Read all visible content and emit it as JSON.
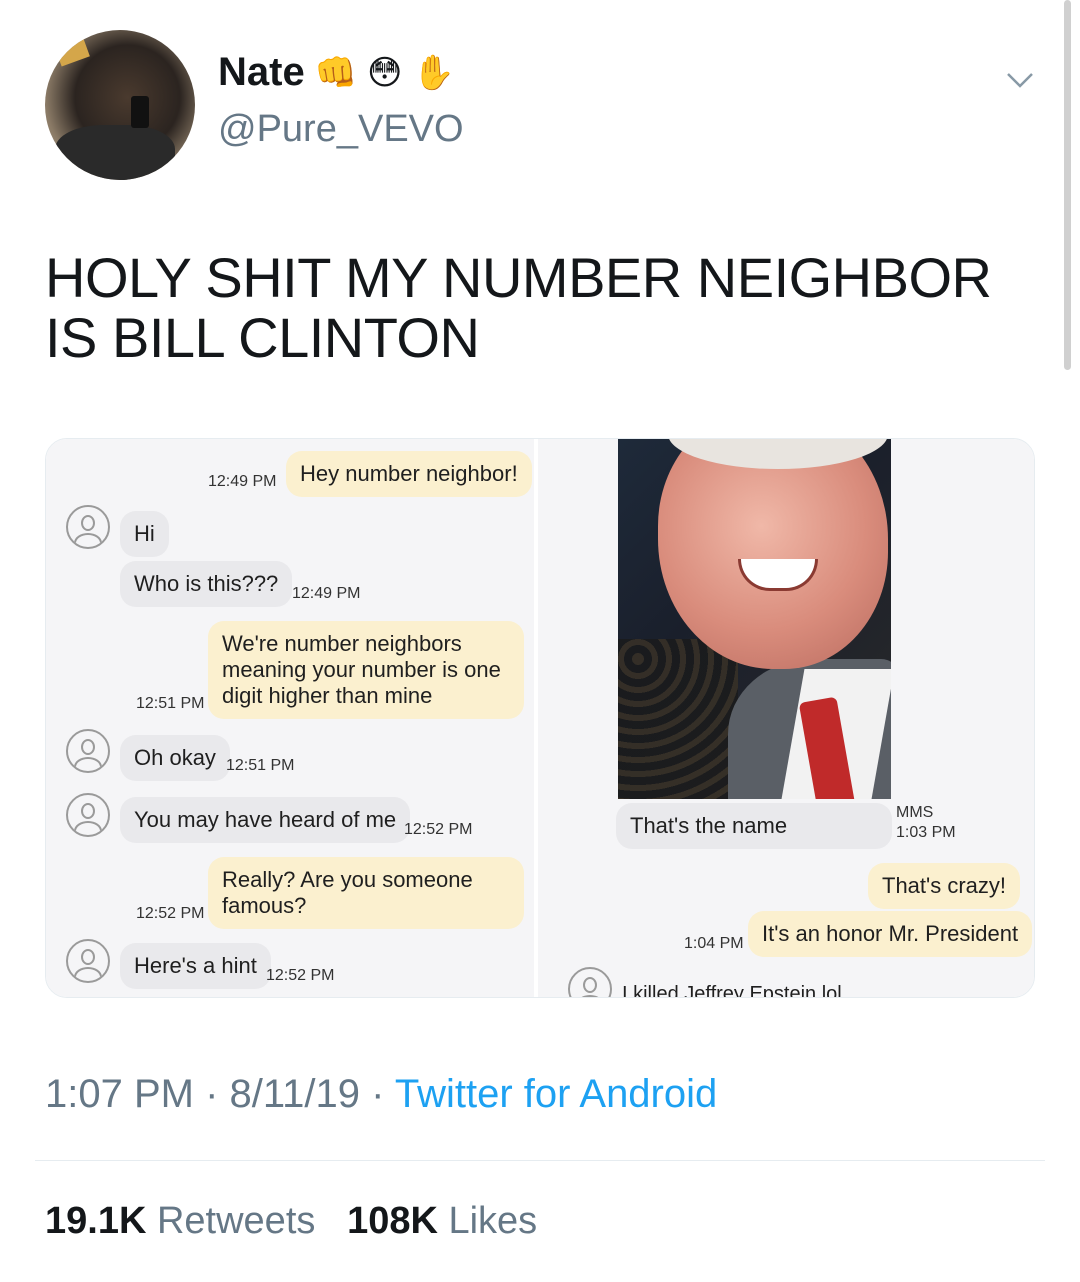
{
  "user": {
    "display_name": "Nate",
    "emojis": [
      "👊",
      "😳",
      "✋"
    ],
    "handle": "@Pure_VEVO"
  },
  "tweet": {
    "text": "HOLY SHIT MY NUMBER NEIGHBOR IS BILL CLINTON"
  },
  "conversation_left": [
    {
      "side": "sent",
      "text": "Hey number neighbor!",
      "time": "12:49 PM"
    },
    {
      "side": "recv",
      "text": "Hi",
      "time": ""
    },
    {
      "side": "recv",
      "text": "Who is this???",
      "time": "12:49 PM"
    },
    {
      "side": "sent",
      "text": "We're number neighbors meaning your number is one digit higher than mine",
      "time": "12:51 PM"
    },
    {
      "side": "recv",
      "text": "Oh okay",
      "time": "12:51 PM"
    },
    {
      "side": "recv",
      "text": "You may have heard of me",
      "time": "12:52 PM"
    },
    {
      "side": "sent",
      "text": "Really? Are you someone famous?",
      "time": "12:52 PM"
    },
    {
      "side": "recv",
      "text": "Here's a hint",
      "time": "12:52 PM"
    }
  ],
  "conversation_right": [
    {
      "side": "recv",
      "text": "That's the name",
      "time": "1:03 PM",
      "label": "MMS"
    },
    {
      "side": "sent",
      "text": "That's crazy!",
      "time": ""
    },
    {
      "side": "sent",
      "text": "It's an honor Mr. President",
      "time": "1:04 PM"
    },
    {
      "side": "recv",
      "text": "I killed Jeffrey Epstein lol",
      "time": ""
    }
  ],
  "footer": {
    "time": "1:07 PM",
    "date": "8/11/19",
    "separator": "·",
    "source": "Twitter for Android"
  },
  "stats": {
    "retweets_count": "19.1K",
    "retweets_label": "Retweets",
    "likes_count": "108K",
    "likes_label": "Likes"
  }
}
